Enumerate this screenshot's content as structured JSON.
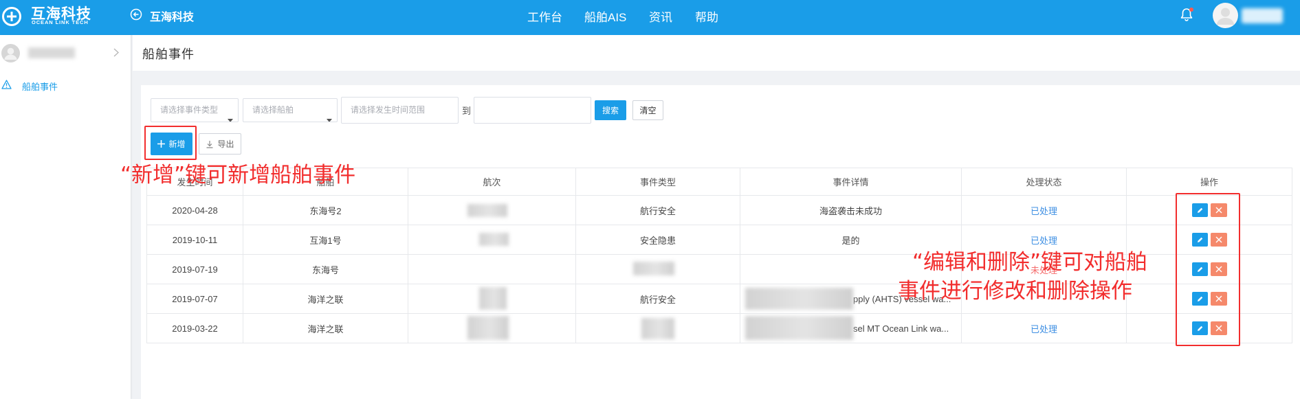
{
  "theme": {
    "primary": "#1a9de8",
    "danger": "#f5896b",
    "annotation": "#f22d2d",
    "link": "#3e8fe3",
    "pending": "#f56c6c"
  },
  "header": {
    "logo_name": "互海科技",
    "logo_sub": "OCEAN LINK TECH",
    "back_title": "互海科技",
    "nav": [
      "工作台",
      "船舶AIS",
      "资讯",
      "帮助"
    ]
  },
  "sidebar": {
    "menu_label": "船舶事件"
  },
  "page": {
    "title": "船舶事件"
  },
  "filters": {
    "event_type_placeholder": "请选择事件类型",
    "ship_placeholder": "请选择船舶",
    "date_from_placeholder": "请选择发生时间范围",
    "to_label": "到",
    "date_to_value": "",
    "search_label": "搜索",
    "clear_label": "清空"
  },
  "actions": {
    "add_label": "新增",
    "export_label": "导出"
  },
  "table": {
    "columns": [
      "发生时间",
      "船舶",
      "航次",
      "事件类型",
      "事件详情",
      "处理状态",
      "操作"
    ],
    "rows": [
      {
        "date": "2020-04-28",
        "ship": "东海号2",
        "voyage": "",
        "type": "航行安全",
        "detail": "海盗袭击未成功",
        "status": "已处理",
        "status_color": "#3e8fe3"
      },
      {
        "date": "2019-10-11",
        "ship": "互海1号",
        "voyage": "",
        "type": "安全隐患",
        "detail": "是的",
        "status": "已处理",
        "status_color": "#3e8fe3"
      },
      {
        "date": "2019-07-19",
        "ship": "东海号",
        "voyage": "",
        "type": "",
        "detail": "",
        "status": "未处理",
        "status_color": "#f56c6c"
      },
      {
        "date": "2019-07-07",
        "ship": "海洋之联",
        "voyage": "",
        "type": "航行安全",
        "detail": "pply (AHTS) vessel wa...",
        "status": "",
        "status_color": "#3e8fe3"
      },
      {
        "date": "2019-03-22",
        "ship": "海洋之联",
        "voyage": "",
        "type": "",
        "detail": "sel MT Ocean Link wa...",
        "status": "已处理",
        "status_color": "#3e8fe3"
      }
    ]
  },
  "annotations": {
    "add_note": "“新增”键可新增船舶事件",
    "edit_note_line1": "“编辑和删除”键可对船舶",
    "edit_note_line2": "事件进行修改和删除操作"
  }
}
